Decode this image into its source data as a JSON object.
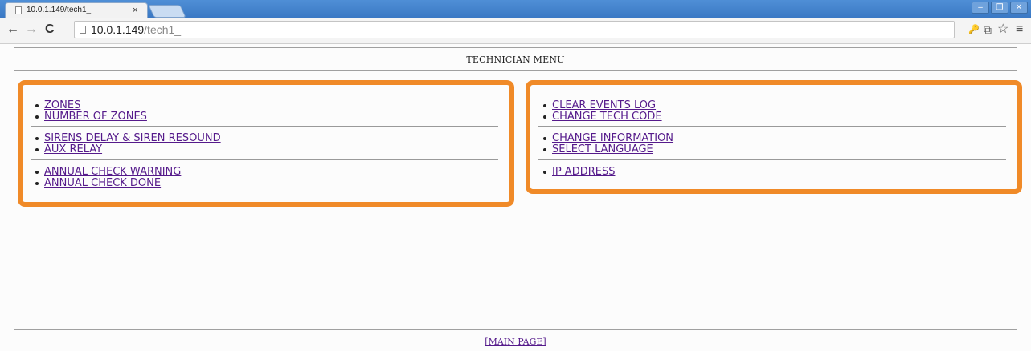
{
  "browser": {
    "tab_title": "10.0.1.149/tech1_",
    "tab_close": "×",
    "url_host": "10.0.1.149",
    "url_path": "/tech1_",
    "minimize": "–",
    "maximize": "❐",
    "close": "✕",
    "back": "←",
    "forward": "→",
    "reload": "C",
    "key_icon": "🔑",
    "translate_icon": "⧉",
    "star": "☆",
    "menu": "≡"
  },
  "page": {
    "title": "TECHNICIAN MENU",
    "left_panel": {
      "groups": [
        [
          "ZONES",
          "NUMBER OF ZONES"
        ],
        [
          "SIRENS DELAY & SIREN RESOUND",
          "AUX RELAY"
        ],
        [
          "ANNUAL CHECK WARNING",
          "ANNUAL CHECK DONE"
        ]
      ]
    },
    "right_panel": {
      "groups": [
        [
          "CLEAR EVENTS LOG",
          "CHANGE TECH CODE"
        ],
        [
          "CHANGE INFORMATION",
          "SELECT LANGUAGE"
        ],
        [
          "IP ADDRESS"
        ]
      ]
    },
    "footer_link": "[MAIN PAGE]"
  },
  "colors": {
    "panel_border": "#f08a28",
    "link": "#551a8b",
    "chrome_blue": "#3a78c4"
  }
}
